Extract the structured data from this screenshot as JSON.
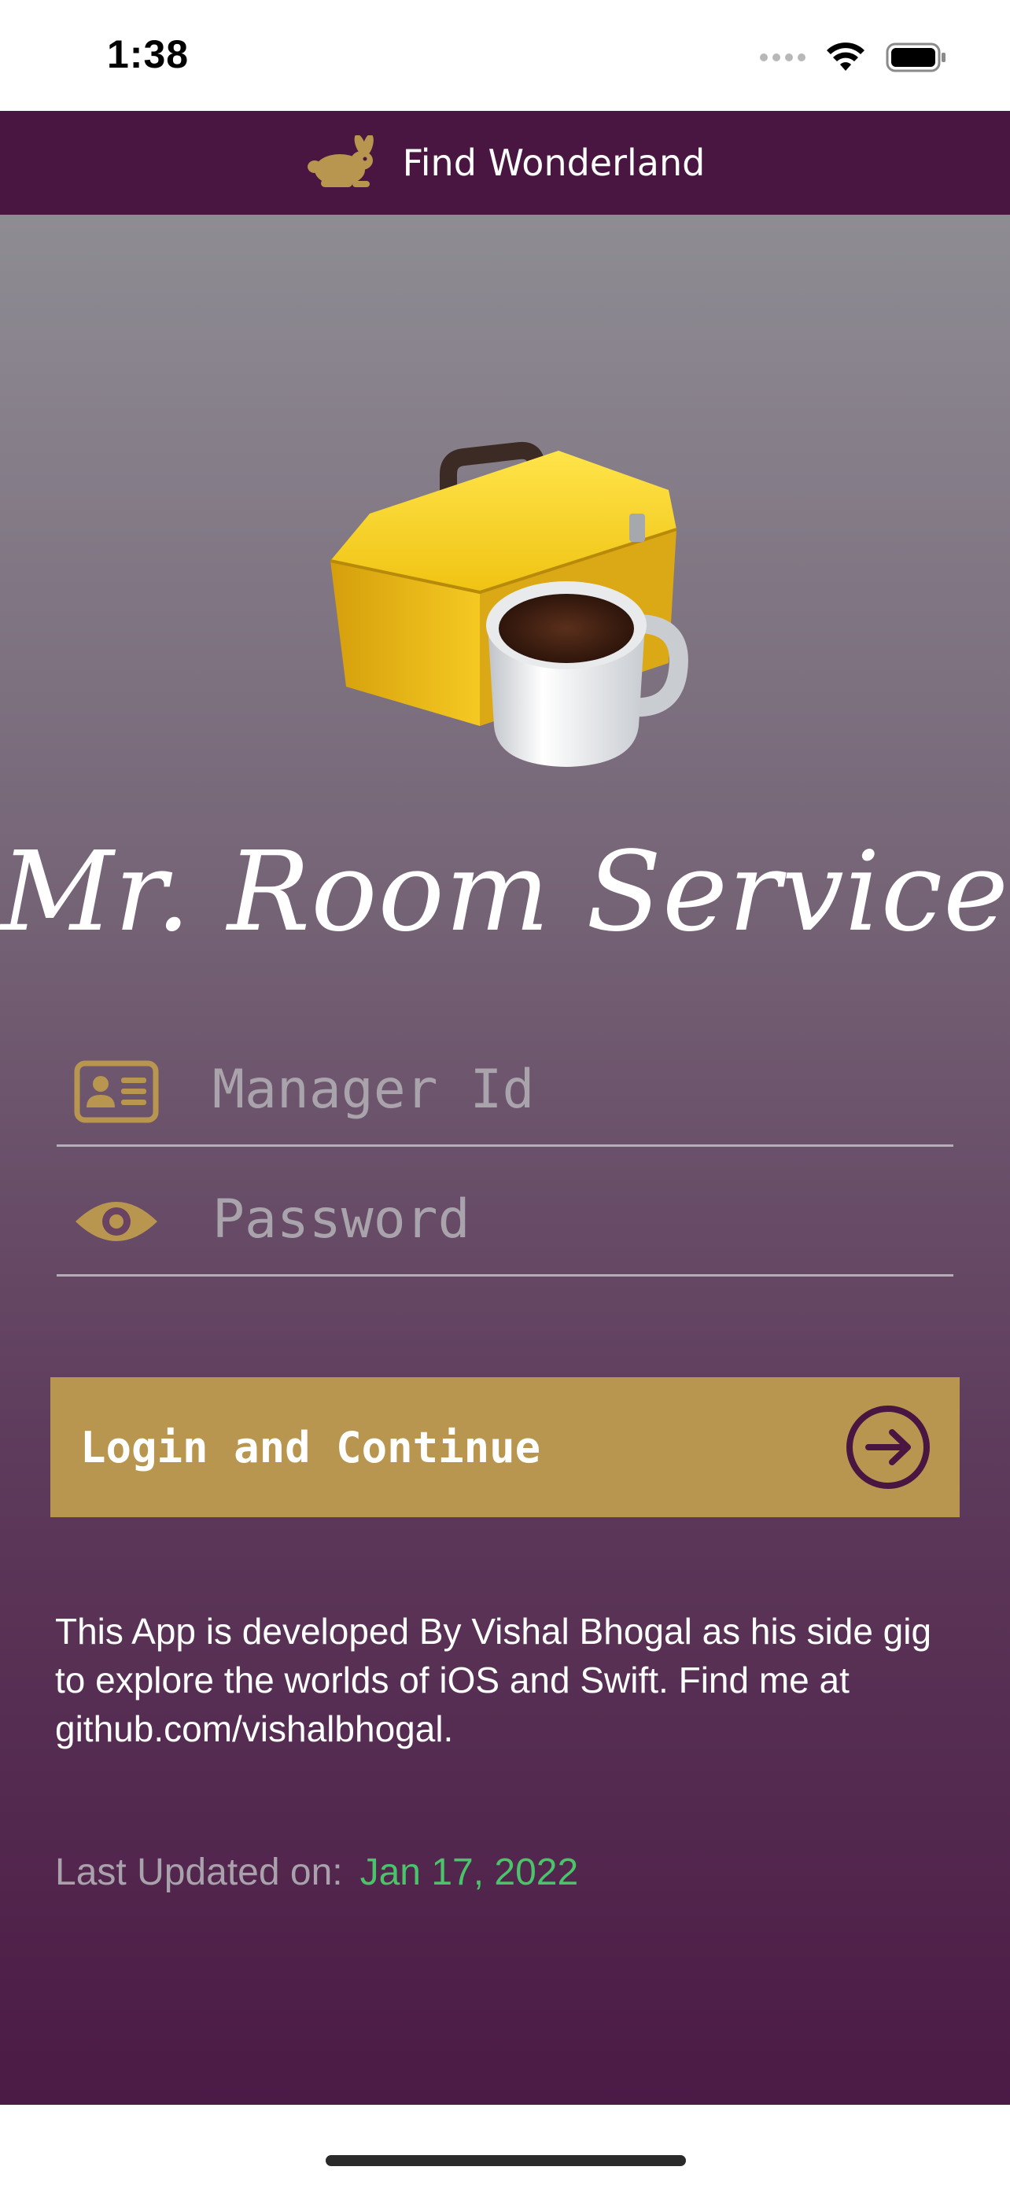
{
  "status_bar": {
    "time": "1:38",
    "icons": [
      "signal-dots-icon",
      "wifi-icon",
      "battery-icon"
    ]
  },
  "nav": {
    "title": "Find Wonderland",
    "logo_icon": "rabbit-icon"
  },
  "hero": {
    "icon": "toolbox-coffee-icon"
  },
  "app_title": "Mr. Room Service",
  "form": {
    "manager_id": {
      "placeholder": "Manager Id",
      "value": "",
      "icon": "id-card-icon"
    },
    "password": {
      "placeholder": "Password",
      "value": "",
      "icon": "eye-icon"
    }
  },
  "login_button": {
    "label": "Login and Continue",
    "icon": "arrow-right-circle-icon"
  },
  "info_text": "This App is developed By Vishal Bhogal as his side gig to explore the worlds of iOS and Swift. Find me at github.com/vishalbhogal.",
  "updated": {
    "label": "Last Updated on:",
    "date": "Jan 17, 2022"
  },
  "colors": {
    "nav_background": "#481641",
    "accent_gold": "#b8964f",
    "date_green": "#4ac46a",
    "arrow_dark": "#481641"
  }
}
